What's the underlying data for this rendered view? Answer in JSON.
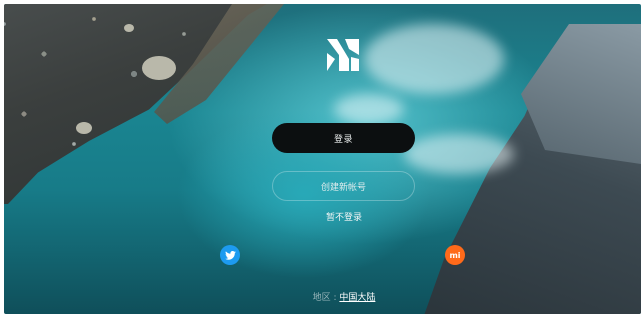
{
  "app": {
    "logo_icon": "brand-logo-icon"
  },
  "auth": {
    "login_label": "登录",
    "register_label": "创建新帐号",
    "skip_label": "暂不登录"
  },
  "social": {
    "twitter_icon": "twitter-icon",
    "mi_label": "mi"
  },
  "region": {
    "label": "地区 : ",
    "value": "中国大陆"
  },
  "colors": {
    "login_button": "#0c0f10",
    "twitter": "#1d9bf0",
    "mi": "#ff6a1a"
  }
}
